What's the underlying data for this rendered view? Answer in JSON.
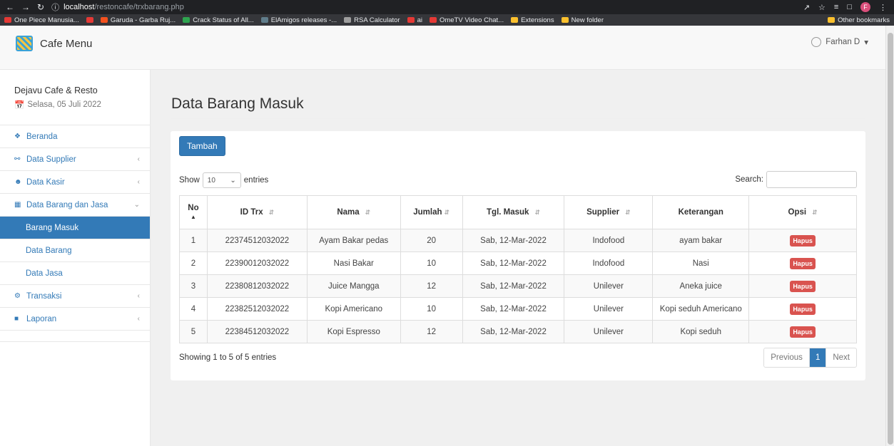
{
  "browser": {
    "url_host": "localhost",
    "url_path": "/restoncafe/trxbarang.php",
    "profile_initial": "F",
    "bookmarks": [
      {
        "label": "One Piece Manusia...",
        "color": "#e53935"
      },
      {
        "label": "",
        "color": "#e53935"
      },
      {
        "label": "Garuda - Garba Ruj...",
        "color": "#f4511e"
      },
      {
        "label": "Crack Status of All...",
        "color": "#2ea44f"
      },
      {
        "label": "ElAmigos releases -...",
        "color": "#607d8b"
      },
      {
        "label": "RSA Calculator",
        "color": "#9e9e9e"
      },
      {
        "label": "ai",
        "color": "#e53935"
      },
      {
        "label": "OmeTV Video Chat...",
        "color": "#e53935"
      },
      {
        "label": "Extensions",
        "color": "#fbc02d"
      },
      {
        "label": "New folder",
        "color": "#fbc02d"
      }
    ],
    "other_bookmarks": "Other bookmarks"
  },
  "header": {
    "brand": "Cafe Menu",
    "user": "Farhan D"
  },
  "sidebar": {
    "cafe_name": "Dejavu Cafe & Resto",
    "date": "Selasa, 05 Juli 2022",
    "items": [
      {
        "label": "Beranda",
        "icon": "home-icon"
      },
      {
        "label": "Data Supplier",
        "icon": "sitemap-icon"
      },
      {
        "label": "Data Kasir",
        "icon": "users-icon"
      },
      {
        "label": "Data Barang dan Jasa",
        "icon": "grid-icon"
      },
      {
        "label": "Barang Masuk"
      },
      {
        "label": "Data Barang"
      },
      {
        "label": "Data Jasa"
      },
      {
        "label": "Transaksi",
        "icon": "gear-icon"
      },
      {
        "label": "Laporan",
        "icon": "folder-icon"
      }
    ]
  },
  "main": {
    "title": "Data Barang Masuk",
    "add_button": "Tambah",
    "show_label": "Show",
    "entries_value": "10",
    "entries_label": "entries",
    "search_label": "Search:",
    "columns": [
      "No",
      "ID Trx",
      "Nama",
      "Jumlah",
      "Tgl. Masuk",
      "Supplier",
      "Keterangan",
      "Opsi"
    ],
    "rows": [
      [
        "1",
        "22374512032022",
        "Ayam Bakar pedas",
        "20",
        "Sab, 12-Mar-2022",
        "Indofood",
        "ayam bakar",
        "Hapus"
      ],
      [
        "2",
        "22390012032022",
        "Nasi Bakar",
        "10",
        "Sab, 12-Mar-2022",
        "Indofood",
        "Nasi",
        "Hapus"
      ],
      [
        "3",
        "22380812032022",
        "Juice Mangga",
        "12",
        "Sab, 12-Mar-2022",
        "Unilever",
        "Aneka juice",
        "Hapus"
      ],
      [
        "4",
        "22382512032022",
        "Kopi Americano",
        "10",
        "Sab, 12-Mar-2022",
        "Unilever",
        "Kopi seduh Americano",
        "Hapus"
      ],
      [
        "5",
        "22384512032022",
        "Kopi Espresso",
        "12",
        "Sab, 12-Mar-2022",
        "Unilever",
        "Kopi seduh",
        "Hapus"
      ]
    ],
    "info": "Showing 1 to 5 of 5 entries",
    "pager": {
      "prev": "Previous",
      "current": "1",
      "next": "Next"
    }
  },
  "colors": {
    "primary": "#337ab7",
    "danger": "#d9534f"
  }
}
